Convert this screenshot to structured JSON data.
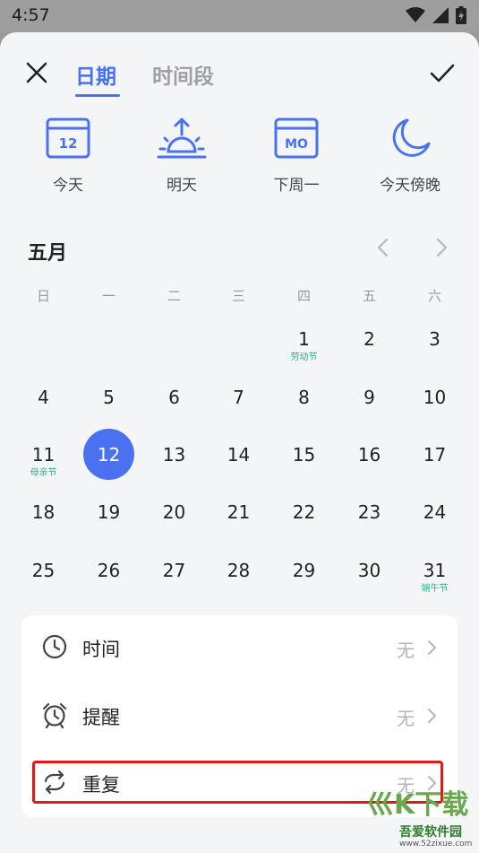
{
  "status": {
    "time": "4:57"
  },
  "tabs": [
    {
      "label": "日期",
      "active": true
    },
    {
      "label": "时间段",
      "active": false
    }
  ],
  "quick_options": [
    {
      "label": "今天",
      "icon": "calendar-today-icon",
      "icon_text": "12"
    },
    {
      "label": "明天",
      "icon": "sunrise-icon"
    },
    {
      "label": "下周一",
      "icon": "calendar-monday-icon",
      "icon_text": "MO"
    },
    {
      "label": "今天傍晚",
      "icon": "moon-icon"
    }
  ],
  "calendar": {
    "month": "五月",
    "weekdays": [
      "日",
      "一",
      "二",
      "三",
      "四",
      "五",
      "六"
    ],
    "selected": "12",
    "days": [
      {
        "n": "1",
        "sub": "劳动节"
      },
      {
        "n": "2"
      },
      {
        "n": "3"
      },
      {
        "n": "4"
      },
      {
        "n": "5"
      },
      {
        "n": "6"
      },
      {
        "n": "7"
      },
      {
        "n": "8"
      },
      {
        "n": "9"
      },
      {
        "n": "10"
      },
      {
        "n": "11",
        "sub": "母亲节"
      },
      {
        "n": "12"
      },
      {
        "n": "13"
      },
      {
        "n": "14"
      },
      {
        "n": "15"
      },
      {
        "n": "16"
      },
      {
        "n": "17"
      },
      {
        "n": "18"
      },
      {
        "n": "19"
      },
      {
        "n": "20"
      },
      {
        "n": "21"
      },
      {
        "n": "22"
      },
      {
        "n": "23"
      },
      {
        "n": "24"
      },
      {
        "n": "25"
      },
      {
        "n": "26"
      },
      {
        "n": "27"
      },
      {
        "n": "28"
      },
      {
        "n": "29"
      },
      {
        "n": "30"
      },
      {
        "n": "31",
        "sub": "端午节"
      }
    ]
  },
  "settings": [
    {
      "label": "时间",
      "value": "无",
      "icon": "clock-icon"
    },
    {
      "label": "提醒",
      "value": "无",
      "icon": "alarm-clock-icon"
    },
    {
      "label": "重复",
      "value": "无",
      "icon": "repeat-icon"
    }
  ],
  "watermark": {
    "logo": "巛K下载",
    "title": "吾爱软件园",
    "url": "www.52zixue.com"
  },
  "colors": {
    "accent": "#4a72f0",
    "festival": "#1fb58e",
    "highlight": "#e01818"
  }
}
